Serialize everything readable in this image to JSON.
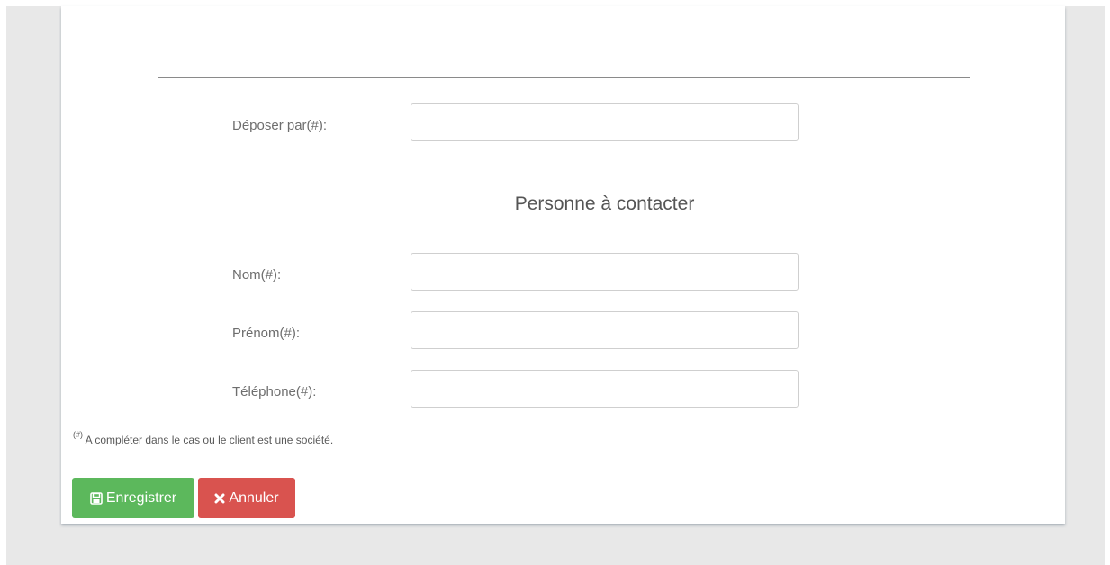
{
  "form": {
    "deposer_label": "Déposer par(#):",
    "deposer_value": "",
    "section_title": "Personne à contacter",
    "nom_label": "Nom(#):",
    "nom_value": "",
    "prenom_label": "Prénom(#):",
    "prenom_value": "",
    "telephone_label": "Téléphone(#):",
    "telephone_value": "",
    "footnote_marker": "(#)",
    "footnote_text": "A compléter dans le cas ou le client est une société."
  },
  "actions": {
    "save_label": "Enregistrer",
    "save_icon": "floppy-disk-icon",
    "save_color": "#5cb85c",
    "cancel_label": "Annuler",
    "cancel_icon": "times-icon",
    "cancel_color": "#d9534f"
  }
}
